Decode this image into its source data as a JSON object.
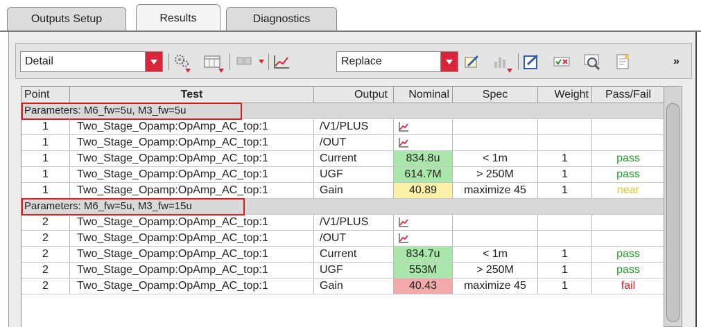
{
  "tabs": [
    {
      "label": "Outputs Setup",
      "active": false
    },
    {
      "label": "Results",
      "active": true
    },
    {
      "label": "Diagnostics",
      "active": false
    }
  ],
  "toolbar": {
    "view_select": "Detail",
    "mode_select": "Replace",
    "overflow": "»",
    "icons": [
      "gear-menu-icon",
      "table-view-menu-icon",
      "sort-menu-icon",
      "waveform-icon",
      "annotate-icon",
      "histogram-menu-icon",
      "edit-checklist-icon",
      "pass-fail-filter-icon",
      "zoom-results-icon",
      "report-icon"
    ],
    "accent": "#d8253b"
  },
  "table": {
    "headers": [
      "Point",
      "Test",
      "Output",
      "Nominal",
      "Spec",
      "Weight",
      "Pass/Fail"
    ],
    "groups": [
      {
        "label": "Parameters: M6_fw=5u, M3_fw=5u",
        "rows": [
          {
            "point": "1",
            "test": "Two_Stage_Opamp:OpAmp_AC_top:1",
            "output": "/V1/PLUS",
            "nominal": "",
            "nominal_type": "wave",
            "spec": "",
            "weight": "",
            "status": "",
            "status_class": ""
          },
          {
            "point": "1",
            "test": "Two_Stage_Opamp:OpAmp_AC_top:1",
            "output": "/OUT",
            "nominal": "",
            "nominal_type": "wave",
            "spec": "",
            "weight": "",
            "status": "",
            "status_class": ""
          },
          {
            "point": "1",
            "test": "Two_Stage_Opamp:OpAmp_AC_top:1",
            "output": "Current",
            "nominal": "834.8u",
            "nominal_type": "pass",
            "spec": "< 1m",
            "weight": "1",
            "status": "pass",
            "status_class": "pass"
          },
          {
            "point": "1",
            "test": "Two_Stage_Opamp:OpAmp_AC_top:1",
            "output": "UGF",
            "nominal": "614.7M",
            "nominal_type": "pass",
            "spec": "> 250M",
            "weight": "1",
            "status": "pass",
            "status_class": "pass"
          },
          {
            "point": "1",
            "test": "Two_Stage_Opamp:OpAmp_AC_top:1",
            "output": "Gain",
            "nominal": "40.89",
            "nominal_type": "near",
            "spec": "maximize 45",
            "weight": "1",
            "status": "near",
            "status_class": "near"
          }
        ]
      },
      {
        "label": "Parameters: M6_fw=5u, M3_fw=15u",
        "rows": [
          {
            "point": "2",
            "test": "Two_Stage_Opamp:OpAmp_AC_top:1",
            "output": "/V1/PLUS",
            "nominal": "",
            "nominal_type": "wave",
            "spec": "",
            "weight": "",
            "status": "",
            "status_class": ""
          },
          {
            "point": "2",
            "test": "Two_Stage_Opamp:OpAmp_AC_top:1",
            "output": "/OUT",
            "nominal": "",
            "nominal_type": "wave",
            "spec": "",
            "weight": "",
            "status": "",
            "status_class": ""
          },
          {
            "point": "2",
            "test": "Two_Stage_Opamp:OpAmp_AC_top:1",
            "output": "Current",
            "nominal": "834.7u",
            "nominal_type": "pass",
            "spec": "< 1m",
            "weight": "1",
            "status": "pass",
            "status_class": "pass"
          },
          {
            "point": "2",
            "test": "Two_Stage_Opamp:OpAmp_AC_top:1",
            "output": "UGF",
            "nominal": "553M",
            "nominal_type": "pass",
            "spec": "> 250M",
            "weight": "1",
            "status": "pass",
            "status_class": "pass"
          },
          {
            "point": "2",
            "test": "Two_Stage_Opamp:OpAmp_AC_top:1",
            "output": "Gain",
            "nominal": "40.43",
            "nominal_type": "fail",
            "spec": "maximize 45",
            "weight": "1",
            "status": "fail",
            "status_class": "fail"
          }
        ]
      }
    ],
    "colors": {
      "pass_bg": "#a9e6a9",
      "near_bg": "#fbf0a6",
      "fail_bg": "#f2a9a9",
      "highlight": "#e01b1b"
    }
  }
}
